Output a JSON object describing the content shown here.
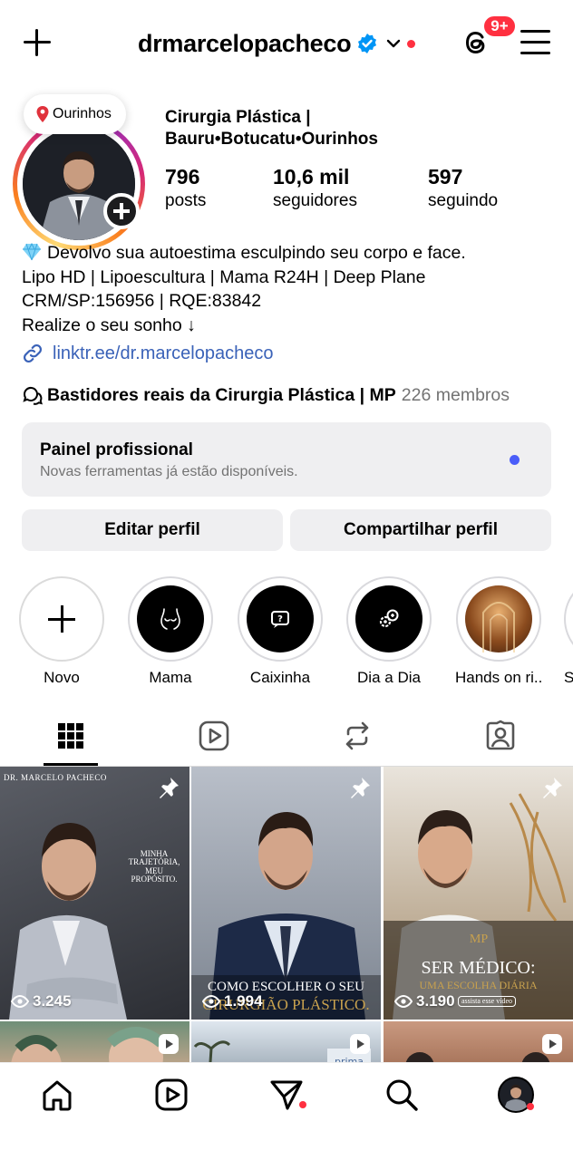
{
  "header": {
    "username": "drmarcelopacheco",
    "notification_badge": "9+"
  },
  "profile": {
    "location_note": "Ourinhos",
    "category_line1": "Cirurgia Plástica |",
    "category_line2": "Bauru•Botucatu•Ourinhos",
    "stats": [
      {
        "value": "796",
        "label": "posts"
      },
      {
        "value": "10,6 mil",
        "label": "seguidores"
      },
      {
        "value": "597",
        "label": "seguindo"
      }
    ],
    "bio": [
      "Devolvo sua autoestima esculpindo seu corpo e face.",
      "Lipo HD | Lipoescultura | Mama R24H | Deep Plane",
      "CRM/SP:156956 | RQE:83842",
      "Realize o seu sonho ↓"
    ],
    "link": "linktr.ee/dr.marcelopacheco",
    "channel": {
      "name": "Bastidores reais da Cirurgia Plástica | MP",
      "members": "226 membros"
    }
  },
  "panel": {
    "title": "Painel profissional",
    "subtitle": "Novas ferramentas já estão disponíveis."
  },
  "buttons": {
    "edit": "Editar perfil",
    "share": "Compartilhar perfil"
  },
  "highlights": [
    {
      "label": "Novo"
    },
    {
      "label": "Mama"
    },
    {
      "label": "Caixinha"
    },
    {
      "label": "Dia a Dia"
    },
    {
      "label": "Hands on ri..."
    },
    {
      "label": "S"
    }
  ],
  "grid": {
    "posts": [
      {
        "views": "3.245",
        "top_text": "DR. MARCELO PACHECO",
        "side_text": "MINHA TRAJETÓRIA, MEU PROPÓSITO."
      },
      {
        "views": "1.994",
        "caption1": "COMO ESCOLHER O SEU",
        "caption2": "CIRURGIÃO PLÁSTICO."
      },
      {
        "views": "3.190",
        "logo": "MP",
        "caption1": "SER MÉDICO:",
        "caption2": "UMA ESCOLHA DIÁRIA",
        "caption3": "assista esse vídeo"
      }
    ]
  },
  "colors": {
    "accent_red": "#ff3040",
    "link_blue": "#3a62b8",
    "verified_blue": "#0095f6"
  }
}
